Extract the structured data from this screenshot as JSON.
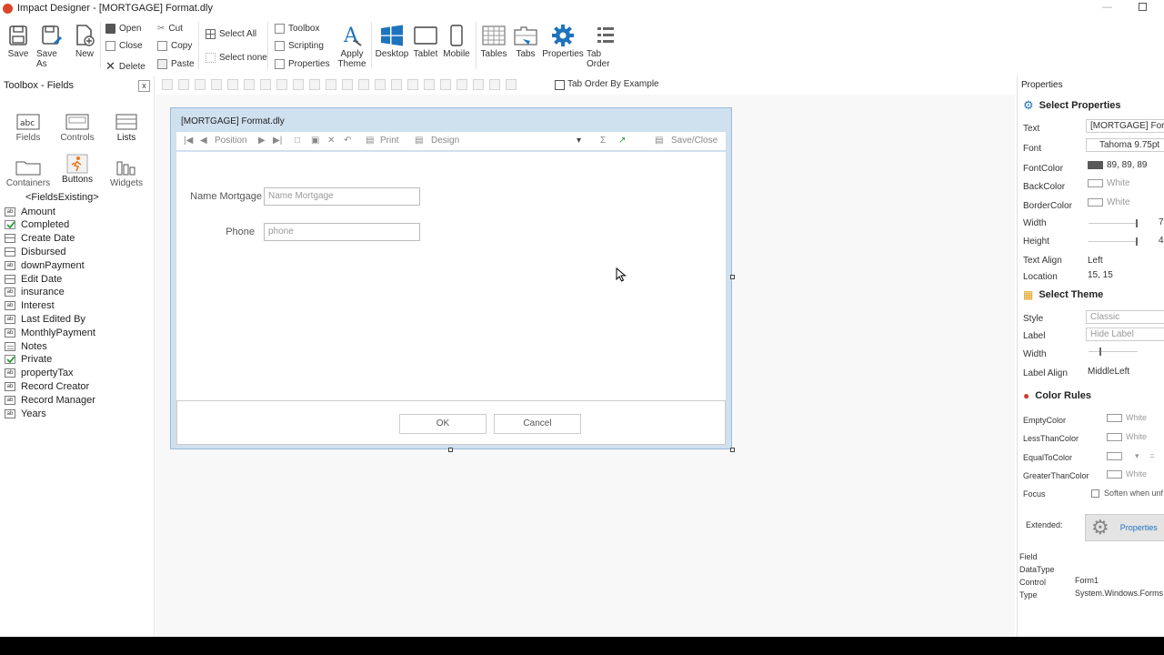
{
  "window": {
    "title": "Impact Designer - [MORTGAGE] Format.dly"
  },
  "ribbon": {
    "save": "Save",
    "save_as": "Save As",
    "new": "New",
    "open": "Open",
    "close": "Close",
    "delete": "Delete",
    "cut": "Cut",
    "copy": "Copy",
    "paste": "Paste",
    "select_all": "Select All",
    "select_none": "Select none",
    "toolbox": "Toolbox",
    "scripting": "Scripting",
    "properties_toggle": "Properties",
    "apply_theme_line1": "Apply",
    "apply_theme_line2": "Theme",
    "desktop": "Desktop",
    "tablet": "Tablet",
    "mobile": "Mobile",
    "tables": "Tables",
    "tabs": "Tabs",
    "properties": "Properties",
    "tab_order": "Tab Order"
  },
  "toolbox": {
    "title": "Toolbox - Fields",
    "close": "x",
    "categories": [
      "Fields",
      "Controls",
      "Lists",
      "Containers",
      "Buttons",
      "Widgets"
    ],
    "existing_header": "<FieldsExisting>",
    "fields": [
      {
        "name": "Amount",
        "icon": "text-field-icon"
      },
      {
        "name": "Completed",
        "icon": "checkbox-icon"
      },
      {
        "name": "Create Date",
        "icon": "date-field-icon"
      },
      {
        "name": "Disbursed",
        "icon": "date-field-icon"
      },
      {
        "name": "downPayment",
        "icon": "text-field-icon"
      },
      {
        "name": "Edit Date",
        "icon": "date-field-icon"
      },
      {
        "name": "insurance",
        "icon": "text-field-icon"
      },
      {
        "name": "Interest",
        "icon": "text-field-icon"
      },
      {
        "name": "Last Edited By",
        "icon": "text-field-icon"
      },
      {
        "name": "MonthlyPayment",
        "icon": "text-field-icon"
      },
      {
        "name": "Notes",
        "icon": "memo-field-icon"
      },
      {
        "name": "Private",
        "icon": "checkbox-icon"
      },
      {
        "name": "propertyTax",
        "icon": "text-field-icon"
      },
      {
        "name": "Record Creator",
        "icon": "text-field-icon"
      },
      {
        "name": "Record Manager",
        "icon": "text-field-icon"
      },
      {
        "name": "Years",
        "icon": "text-field-icon"
      }
    ]
  },
  "align_toolbar": {
    "tab_order_by_example": "Tab Order By Example"
  },
  "form": {
    "title": "[MORTGAGE] Format.dly",
    "nav": {
      "position": "Position",
      "print": "Print",
      "design": "Design",
      "save_close": "Save/Close"
    },
    "fields": [
      {
        "label": "Name Mortgage",
        "placeholder": "Name Mortgage"
      },
      {
        "label": "Phone",
        "placeholder": "phone"
      }
    ],
    "ok": "OK",
    "cancel": "Cancel"
  },
  "properties": {
    "header": "Properties",
    "select_properties": "Select Properties",
    "text_label": "Text",
    "text_value": "[MORTGAGE] Format",
    "font_label": "Font",
    "font_value": "Tahoma 9.75pt",
    "fontcolor_label": "FontColor",
    "fontcolor_value": "89, 89, 89",
    "backcolor_label": "BackColor",
    "backcolor_value": "White",
    "bordercolor_label": "BorderColor",
    "bordercolor_value": "White",
    "width_label": "Width",
    "width_value": "7",
    "height_label": "Height",
    "height_value": "4",
    "textalign_label": "Text Align",
    "textalign_value": "Left",
    "location_label": "Location",
    "location_value": "15, 15",
    "select_theme": "Select Theme",
    "style_label": "Style",
    "style_value": "Classic",
    "label_label": "Label",
    "label_value": "Hide Label",
    "theme_width_label": "Width",
    "labelalign_label": "Label Align",
    "labelalign_value": "MiddleLeft",
    "color_rules": "Color Rules",
    "emptycolor_label": "EmptyColor",
    "emptycolor_value": "White",
    "lessthan_label": "LessThanColor",
    "lessthan_value": "White",
    "equalto_label": "EqualToColor",
    "equalto_value": "=",
    "greaterthan_label": "GreaterThanColor",
    "greaterthan_value": "White",
    "focus_label": "Focus",
    "focus_value": "Soften when unf",
    "extended_label": "Extended:",
    "extended_button": "Properties",
    "field_label": "Field",
    "datatype_label": "DataType",
    "control_label": "Control",
    "control_value": "Form1",
    "type_label": "Type",
    "type_value": "System.Windows.Forms"
  },
  "colors": {
    "accent": "#1e73be",
    "fontcolor": "#595959",
    "form_border": "#9bbbd8",
    "status_bar": "#000000"
  }
}
